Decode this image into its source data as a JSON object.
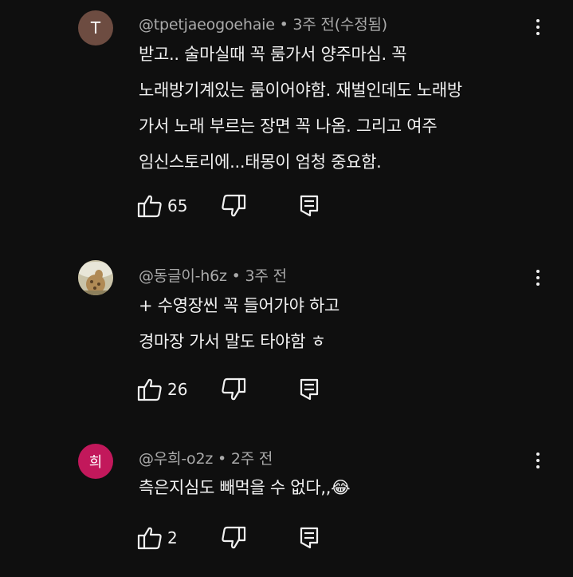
{
  "comments": [
    {
      "avatar_letter": "T",
      "avatar_color": "#6d4c41",
      "author": "@tpetjaeogoehaie",
      "separator": "•",
      "time": "3주 전(수정됨)",
      "lines": [
        "받고.. 술마실때 꼭 룸가서 양주마심. 꼭",
        "노래방기계있는 룸이어야함. 재벌인데도 노래방",
        "가서 노래 부르는 장면 꼭 나옴. 그리고 여주",
        "임신스토리에...태몽이 엄청 중요함."
      ],
      "likes": "65"
    },
    {
      "avatar_letter": "",
      "avatar_color": "#8a7a5a",
      "author": "@동글이-h6z",
      "separator": "•",
      "time": "3주 전",
      "lines": [
        "+ 수영장씬 꼭 들어가야 하고",
        "경마장 가서 말도 타야함 ㅎ"
      ],
      "likes": "26"
    },
    {
      "avatar_letter": "희",
      "avatar_color": "#c2185b",
      "author": "@우희-o2z",
      "separator": "•",
      "time": "2주 전",
      "lines": [
        "측은지심도 빼먹을 수 없다,,😂"
      ],
      "likes": "2"
    }
  ]
}
